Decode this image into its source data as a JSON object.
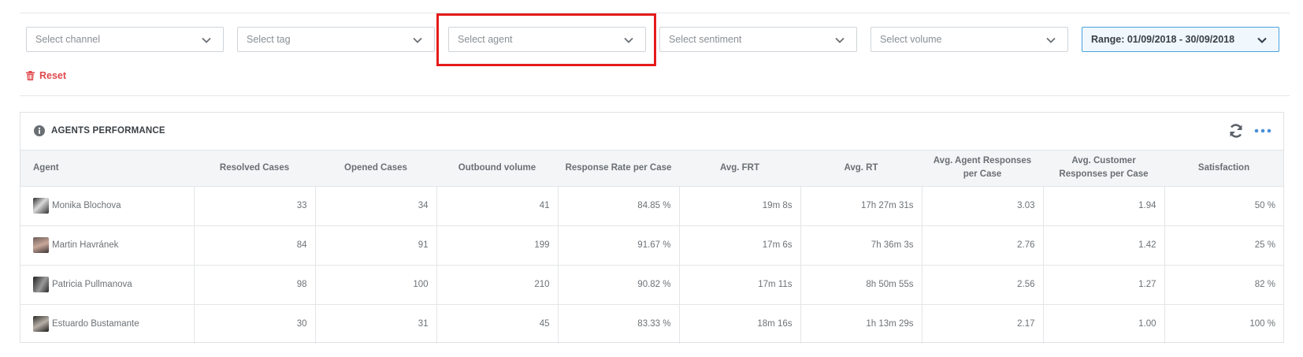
{
  "filters": {
    "channel": "Select channel",
    "tag": "Select tag",
    "agent": "Select agent",
    "sentiment": "Select sentiment",
    "volume": "Select volume",
    "range": "Range: 01/09/2018 - 30/09/2018"
  },
  "reset_label": "Reset",
  "panel": {
    "title": "AGENTS PERFORMANCE",
    "columns": [
      "Agent",
      "Resolved Cases",
      "Opened Cases",
      "Outbound volume",
      "Response Rate per Case",
      "Avg. FRT",
      "Avg. RT",
      "Avg. Agent Responses per Case",
      "Avg. Customer Responses per Case",
      "Satisfaction"
    ],
    "rows": [
      [
        "Monika Blochova",
        "33",
        "34",
        "41",
        "84.85 %",
        "19m 8s",
        "17h 27m 31s",
        "3.03",
        "1.94",
        "50 %"
      ],
      [
        "Martin Havránek",
        "84",
        "91",
        "199",
        "91.67 %",
        "17m 6s",
        "7h 36m 3s",
        "2.76",
        "1.42",
        "25 %"
      ],
      [
        "Patricia Pullmanova",
        "98",
        "100",
        "210",
        "90.82 %",
        "17m 11s",
        "8h 50m 55s",
        "2.56",
        "1.27",
        "82 %"
      ],
      [
        "Estuardo Bustamante",
        "30",
        "31",
        "45",
        "83.33 %",
        "18m 16s",
        "1h 13m 29s",
        "2.17",
        "1.00",
        "100 %"
      ]
    ]
  },
  "colors": {
    "highlight": "#e41b1b",
    "reset": "#e0484c",
    "range_border": "#4aa3df",
    "accent_icon": "#4a90d9"
  },
  "icons": [
    "chevron-down-icon",
    "trash-icon",
    "info-icon",
    "refresh-icon",
    "more-icon"
  ]
}
